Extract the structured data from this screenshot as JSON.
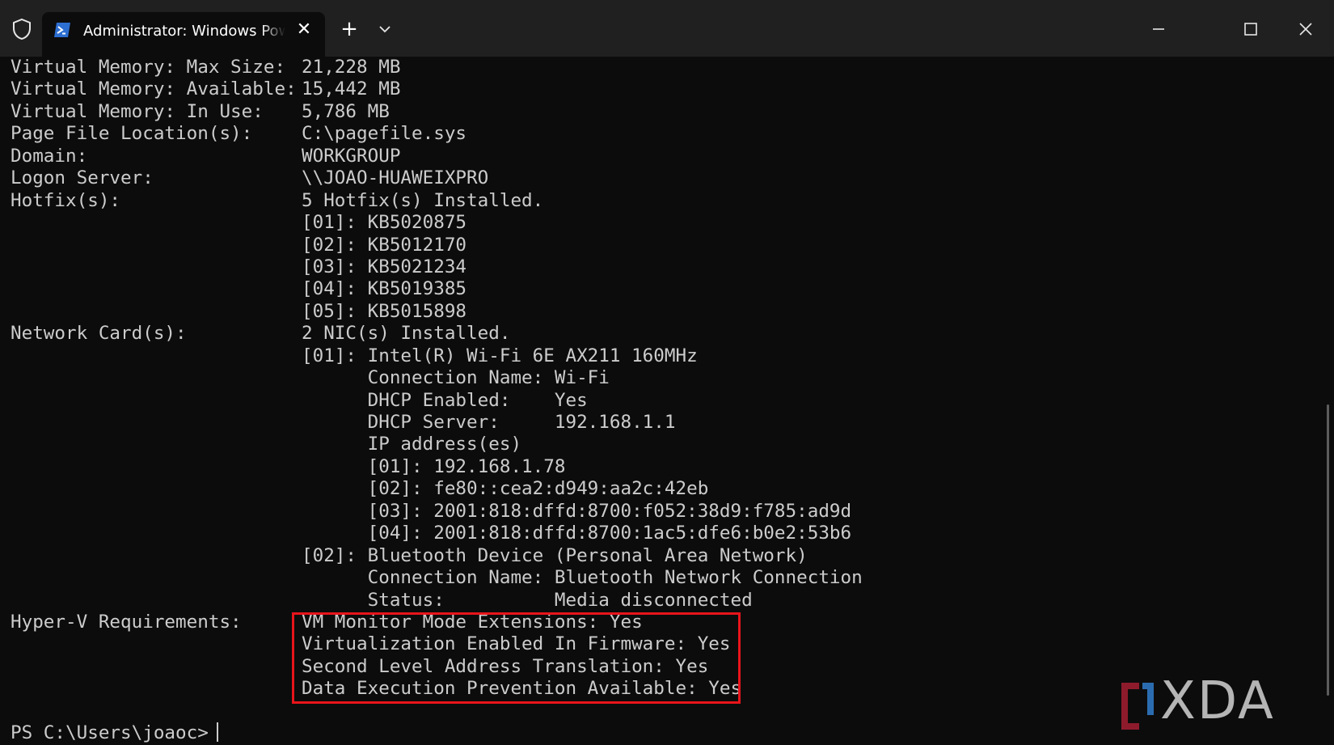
{
  "window": {
    "tab_title": "Administrator: Windows PowerShell",
    "tab_close_glyph": "✕",
    "new_tab_glyph": "+"
  },
  "terminal": {
    "lines": [
      {
        "label": "Virtual Memory: Max Size:",
        "value": "21,228 MB"
      },
      {
        "label": "Virtual Memory: Available:",
        "value": "15,442 MB"
      },
      {
        "label": "Virtual Memory: In Use:",
        "value": "5,786 MB"
      },
      {
        "label": "Page File Location(s):",
        "value": "C:\\pagefile.sys"
      },
      {
        "label": "Domain:",
        "value": "WORKGROUP"
      },
      {
        "label": "Logon Server:",
        "value": "\\\\JOAO-HUAWEIXPRO"
      },
      {
        "label": "Hotfix(s):",
        "value": "5 Hotfix(s) Installed."
      },
      {
        "label": "",
        "value": "[01]: KB5020875"
      },
      {
        "label": "",
        "value": "[02]: KB5012170"
      },
      {
        "label": "",
        "value": "[03]: KB5021234"
      },
      {
        "label": "",
        "value": "[04]: KB5019385"
      },
      {
        "label": "",
        "value": "[05]: KB5015898"
      },
      {
        "label": "Network Card(s):",
        "value": "2 NIC(s) Installed."
      },
      {
        "label": "",
        "value": "[01]: Intel(R) Wi-Fi 6E AX211 160MHz"
      },
      {
        "label": "",
        "value": "      Connection Name: Wi-Fi"
      },
      {
        "label": "",
        "value": "      DHCP Enabled:    Yes"
      },
      {
        "label": "",
        "value": "      DHCP Server:     192.168.1.1"
      },
      {
        "label": "",
        "value": "      IP address(es)"
      },
      {
        "label": "",
        "value": "      [01]: 192.168.1.78"
      },
      {
        "label": "",
        "value": "      [02]: fe80::cea2:d949:aa2c:42eb"
      },
      {
        "label": "",
        "value": "      [03]: 2001:818:dffd:8700:f052:38d9:f785:ad9d"
      },
      {
        "label": "",
        "value": "      [04]: 2001:818:dffd:8700:1ac5:dfe6:b0e2:53b6"
      },
      {
        "label": "",
        "value": "[02]: Bluetooth Device (Personal Area Network)"
      },
      {
        "label": "",
        "value": "      Connection Name: Bluetooth Network Connection"
      },
      {
        "label": "",
        "value": "      Status:          Media disconnected"
      },
      {
        "label": "Hyper-V Requirements:",
        "value": "VM Monitor Mode Extensions: Yes"
      },
      {
        "label": "",
        "value": "Virtualization Enabled In Firmware: Yes"
      },
      {
        "label": "",
        "value": "Second Level Address Translation: Yes"
      },
      {
        "label": "",
        "value": "Data Execution Prevention Available: Yes"
      }
    ],
    "prompt": "PS C:\\Users\\joaoc>"
  },
  "watermark": {
    "text": "XDA"
  },
  "colors": {
    "background": "#0c0c0c",
    "titlebar": "#202020",
    "text": "#cccccc",
    "highlight_border": "#e8141b",
    "powershell_icon": "#2d6fd1"
  }
}
